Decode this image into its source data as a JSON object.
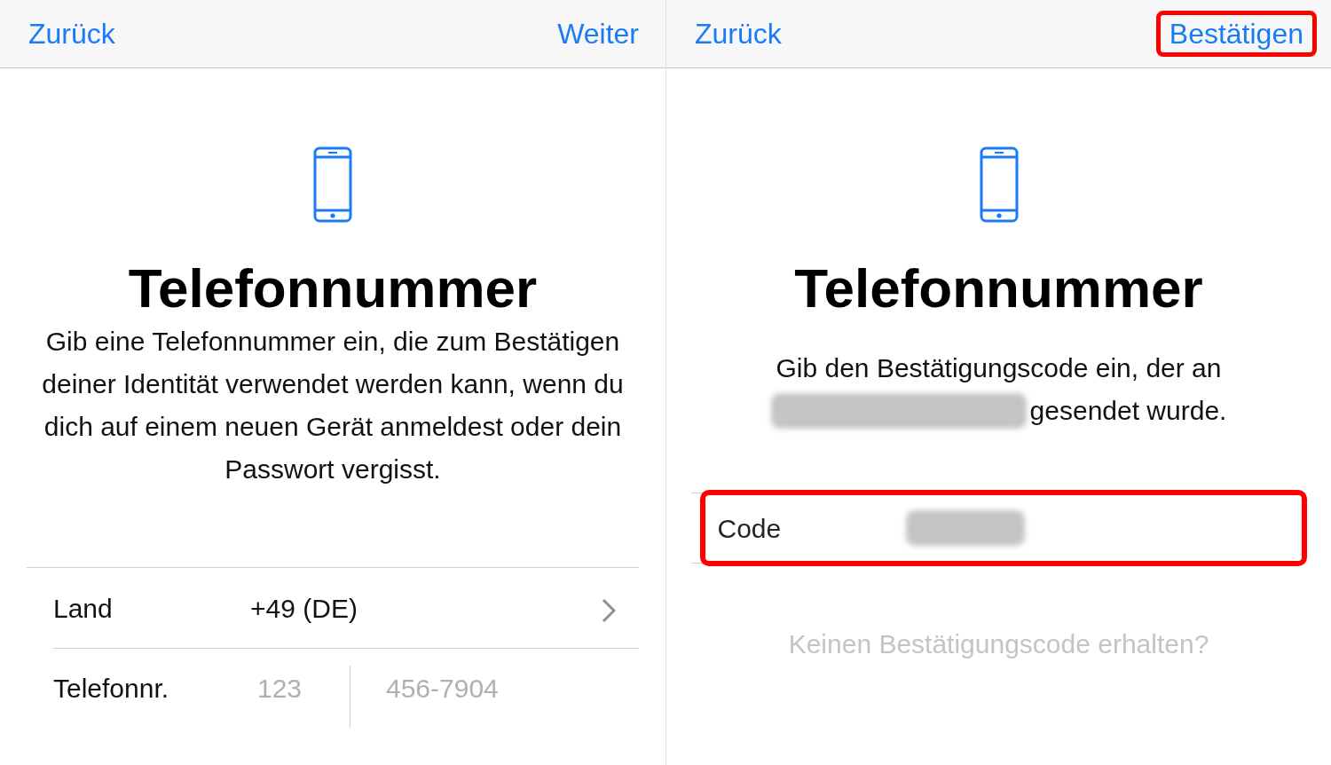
{
  "screens": [
    {
      "nav": {
        "back": "Zurück",
        "next": "Weiter",
        "next_highlighted": false
      },
      "title": "Telefonnummer",
      "description": [
        {
          "text": "Gib eine Telefonnummer ein, die zum Bestätigen deiner Identität verwendet werden kann, wenn du dich auf einem neuen Gerät anmeldest oder dein Passwort vergisst."
        }
      ],
      "form": [
        {
          "kind": "select",
          "label": "Land",
          "value": "+49 (DE)"
        },
        {
          "kind": "phone",
          "label": "Telefonnr.",
          "fields": [
            {
              "placeholder": "123"
            },
            {
              "placeholder": "456-7904"
            }
          ]
        }
      ]
    },
    {
      "nav": {
        "back": "Zurück",
        "next": "Bestätigen",
        "next_highlighted": true
      },
      "title": "Telefonnummer",
      "description": [
        {
          "text": "Gib den Bestätigungscode ein, der an"
        },
        {
          "redacted": true,
          "text": "gesendet wurde."
        }
      ],
      "form": [
        {
          "kind": "code",
          "label": "Code",
          "redacted": true,
          "highlighted": true
        }
      ],
      "link": "Keinen Bestätigungscode erhalten?"
    }
  ]
}
